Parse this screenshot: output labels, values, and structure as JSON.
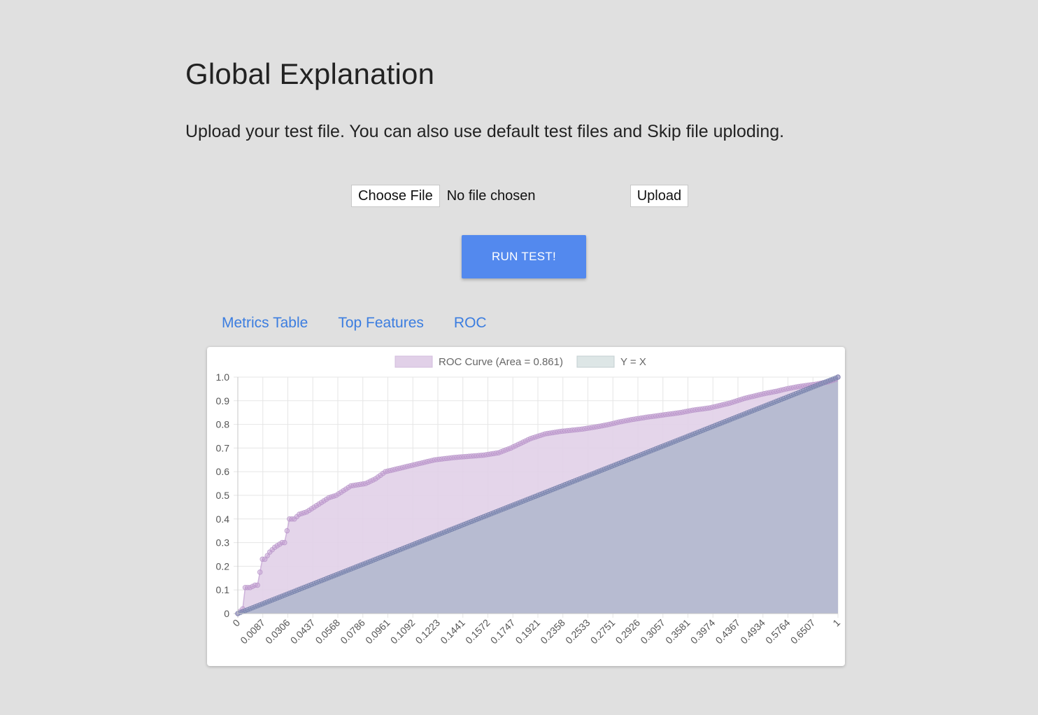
{
  "header": {
    "title": "Global Explanation",
    "subtitle": "Upload your test file. You can also use default test files and Skip file uploding."
  },
  "upload": {
    "choose_label": "Choose File",
    "file_name": "No file chosen",
    "upload_label": "Upload"
  },
  "run_button": {
    "label": "RUN TEST!"
  },
  "tabs": [
    {
      "label": "Metrics Table"
    },
    {
      "label": "Top Features"
    },
    {
      "label": "ROC"
    }
  ],
  "colors": {
    "accent": "#5389ee",
    "link": "#3b7de0",
    "roc_fill": "#e1d0e8",
    "roc_point": "#c9a8d6",
    "diag_fill": "#b4b9d0",
    "diag_point": "#8792b8"
  },
  "chart_data": {
    "type": "area",
    "legend": [
      {
        "name": "ROC Curve (Area = 0.861)"
      },
      {
        "name": "Y = X"
      }
    ],
    "y_ticks": [
      "0",
      "0.1",
      "0.2",
      "0.3",
      "0.4",
      "0.5",
      "0.6",
      "0.7",
      "0.8",
      "0.9",
      "1.0"
    ],
    "x_tick_labels": [
      "0",
      "0.0087",
      "0.0306",
      "0.0437",
      "0.0568",
      "0.0786",
      "0.0961",
      "0.1092",
      "0.1223",
      "0.1441",
      "0.1572",
      "0.1747",
      "0.1921",
      "0.2358",
      "0.2533",
      "0.2751",
      "0.2926",
      "0.3057",
      "0.3581",
      "0.3974",
      "0.4367",
      "0.4934",
      "0.5764",
      "0.6507",
      "1"
    ],
    "ylim": [
      0,
      1
    ],
    "point_count": 245,
    "series": [
      {
        "name": "ROC Curve (Area = 0.861)",
        "profile": [
          [
            0,
            0
          ],
          [
            1,
            0.01
          ],
          [
            2,
            0.02
          ],
          [
            3,
            0.11
          ],
          [
            5,
            0.11
          ],
          [
            7,
            0.12
          ],
          [
            8,
            0.12
          ],
          [
            10,
            0.23
          ],
          [
            11,
            0.23
          ],
          [
            13,
            0.26
          ],
          [
            15,
            0.28
          ],
          [
            18,
            0.3
          ],
          [
            19,
            0.3
          ],
          [
            21,
            0.4
          ],
          [
            23,
            0.4
          ],
          [
            25,
            0.42
          ],
          [
            28,
            0.43
          ],
          [
            31,
            0.45
          ],
          [
            34,
            0.47
          ],
          [
            37,
            0.49
          ],
          [
            40,
            0.5
          ],
          [
            43,
            0.52
          ],
          [
            46,
            0.54
          ],
          [
            52,
            0.55
          ],
          [
            56,
            0.57
          ],
          [
            60,
            0.6
          ],
          [
            64,
            0.61
          ],
          [
            72,
            0.63
          ],
          [
            80,
            0.65
          ],
          [
            88,
            0.66
          ],
          [
            100,
            0.67
          ],
          [
            106,
            0.68
          ],
          [
            111,
            0.7
          ],
          [
            113,
            0.71
          ],
          [
            117,
            0.73
          ],
          [
            119,
            0.74
          ],
          [
            122,
            0.75
          ],
          [
            125,
            0.76
          ],
          [
            131,
            0.77
          ],
          [
            140,
            0.78
          ],
          [
            146,
            0.79
          ],
          [
            151,
            0.8
          ],
          [
            155,
            0.81
          ],
          [
            160,
            0.82
          ],
          [
            166,
            0.83
          ],
          [
            173,
            0.84
          ],
          [
            180,
            0.85
          ],
          [
            185,
            0.86
          ],
          [
            192,
            0.87
          ],
          [
            196,
            0.88
          ],
          [
            200,
            0.89
          ],
          [
            206,
            0.91
          ],
          [
            210,
            0.92
          ],
          [
            214,
            0.93
          ],
          [
            219,
            0.94
          ],
          [
            223,
            0.95
          ],
          [
            228,
            0.96
          ],
          [
            235,
            0.97
          ],
          [
            240,
            0.98
          ],
          [
            243,
            0.99
          ],
          [
            244,
            1.0
          ]
        ]
      },
      {
        "name": "Y = X",
        "profile": [
          [
            0,
            0
          ],
          [
            244,
            1.0
          ]
        ]
      }
    ]
  }
}
